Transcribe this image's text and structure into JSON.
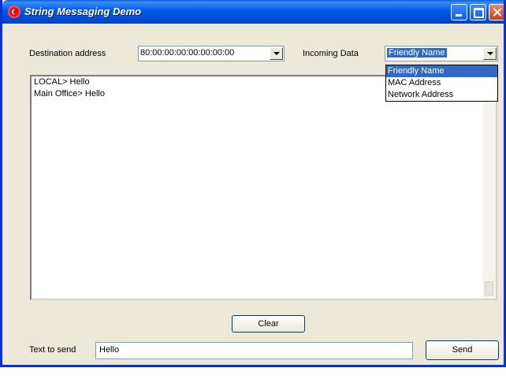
{
  "window": {
    "title": "String Messaging Demo"
  },
  "destination": {
    "label": "Destination address",
    "value": "80:00:00:00:00:00:00:00"
  },
  "incoming": {
    "label": "Incoming Data",
    "selected": "Friendly Name",
    "options": [
      "Friendly Name",
      "MAC Address",
      "Network Address"
    ]
  },
  "log": {
    "lines": [
      "LOCAL> Hello",
      "Main Office> Hello"
    ]
  },
  "actions": {
    "clear_label": "Clear",
    "send_label": "Send"
  },
  "send_text": {
    "label": "Text to send",
    "value": "Hello"
  },
  "colors": {
    "titlebar": "#0058e6",
    "face": "#ece9d8",
    "selection": "#316ac5"
  }
}
